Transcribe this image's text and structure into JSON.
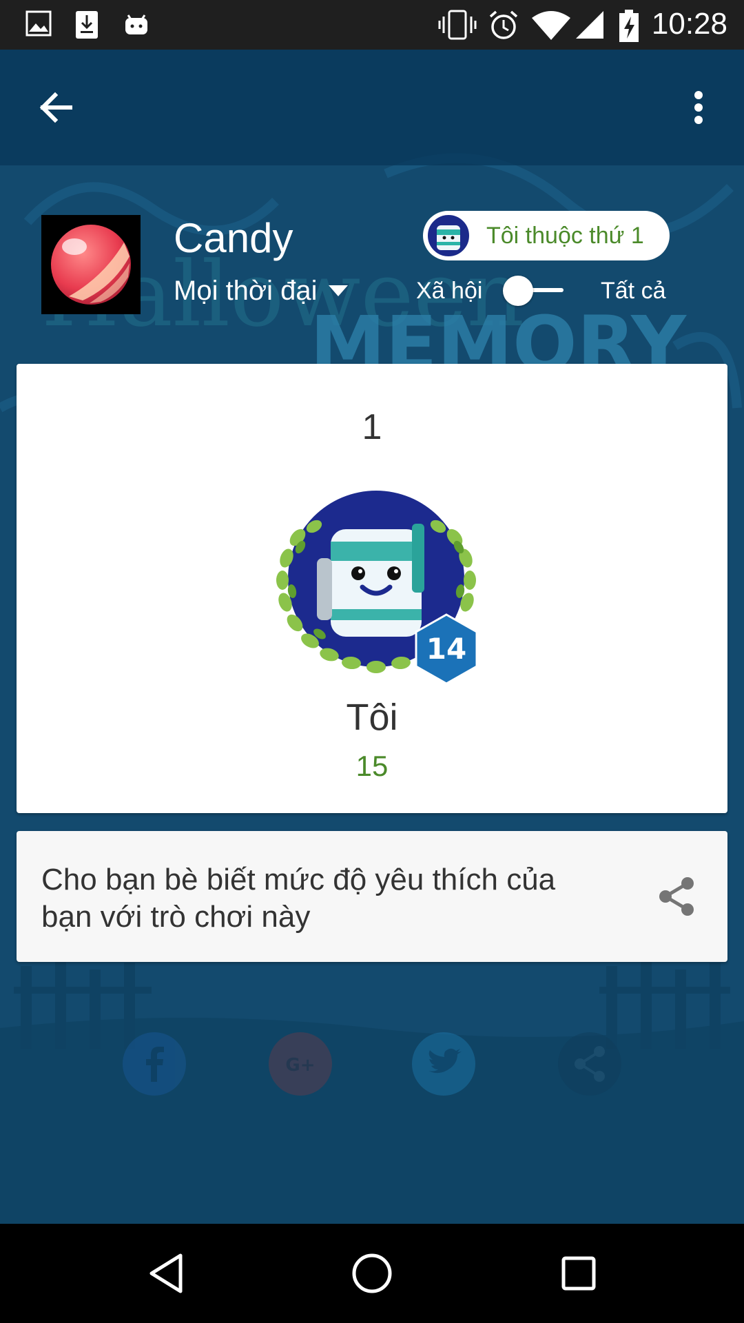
{
  "status_bar": {
    "time": "10:28",
    "left_icons": [
      "image-icon",
      "download-icon",
      "android-icon"
    ],
    "right_icons": [
      "vibrate-icon",
      "alarm-icon",
      "wifi-icon",
      "signal-icon",
      "battery-charging-icon"
    ]
  },
  "toolbar": {
    "back_icon": "arrow-back-icon",
    "menu_icon": "more-vert-icon"
  },
  "header": {
    "game_title": "Candy",
    "time_filter": "Mọi thời đại",
    "rank_pill": "Tôi thuộc thứ 1",
    "scope_left": "Xã hội",
    "scope_right": "Tất cả",
    "scope_switch_on": false
  },
  "rank_card": {
    "rank": "1",
    "level": "14",
    "player_name": "Tôi",
    "score": "15"
  },
  "share_card": {
    "text": "Cho bạn bè biết mức độ yêu thích của bạn với trò chơi này",
    "icon": "share-icon"
  },
  "background_social": {
    "items": [
      "facebook-icon",
      "google-plus-icon",
      "twitter-icon",
      "share-icon"
    ]
  },
  "colors": {
    "background": "#134a6e",
    "toolbar": "#08375a",
    "score_green": "#4b8a2a",
    "level_badge": "#1b72b8"
  },
  "nav_bar": {
    "icons": [
      "nav-back-icon",
      "nav-home-icon",
      "nav-recents-icon"
    ]
  }
}
